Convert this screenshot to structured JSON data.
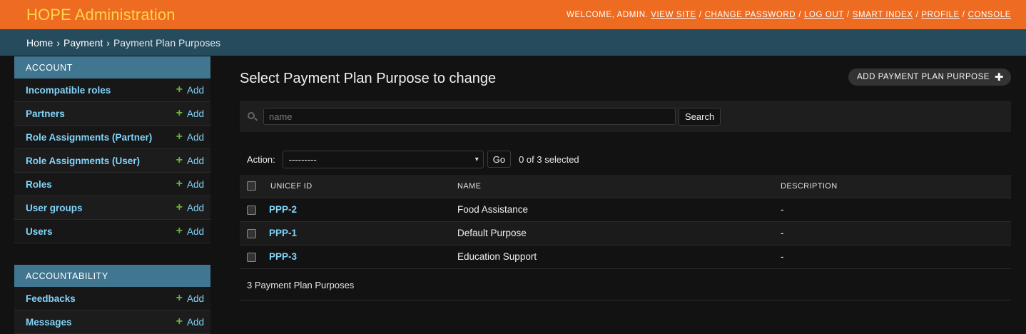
{
  "header": {
    "branding": "HOPE Administration",
    "welcome": "WELCOME,",
    "user": "ADMIN.",
    "links": [
      "VIEW SITE",
      "CHANGE PASSWORD",
      "LOG OUT",
      "SMART INDEX",
      "PROFILE",
      "CONSOLE"
    ]
  },
  "breadcrumbs": [
    "Home",
    "Payment",
    "Payment Plan Purposes"
  ],
  "sidebar": {
    "add_label": "Add",
    "modules": [
      {
        "caption": "ACCOUNT",
        "items": [
          "Incompatible roles",
          "Partners",
          "Role Assignments (Partner)",
          "Role Assignments (User)",
          "Roles",
          "User groups",
          "Users"
        ]
      },
      {
        "caption": "ACCOUNTABILITY",
        "items": [
          "Feedbacks",
          "Messages"
        ]
      }
    ]
  },
  "main": {
    "title": "Select Payment Plan Purpose to change",
    "add_button": "ADD PAYMENT PLAN PURPOSE",
    "search": {
      "placeholder": "name",
      "button": "Search"
    },
    "actions": {
      "label": "Action:",
      "selected": "---------",
      "go": "Go",
      "counter": "0 of 3 selected"
    },
    "table": {
      "columns": [
        "UNICEF ID",
        "NAME",
        "DESCRIPTION"
      ],
      "rows": [
        {
          "id": "PPP-2",
          "name": "Food Assistance",
          "description": "-"
        },
        {
          "id": "PPP-1",
          "name": "Default Purpose",
          "description": "-"
        },
        {
          "id": "PPP-3",
          "name": "Education Support",
          "description": "-"
        }
      ]
    },
    "paginator": "3 Payment Plan Purposes"
  },
  "colors": {
    "header": "#ee6b22",
    "branding": "#ffd34d",
    "breadcrumbs": "#264b5d",
    "module_caption": "#417690",
    "link": "#81d4fa",
    "add_plus": "#6bb33d"
  },
  "icons": {
    "search": "search-icon",
    "add": "plus-icon",
    "select": "chevron-down-icon"
  }
}
